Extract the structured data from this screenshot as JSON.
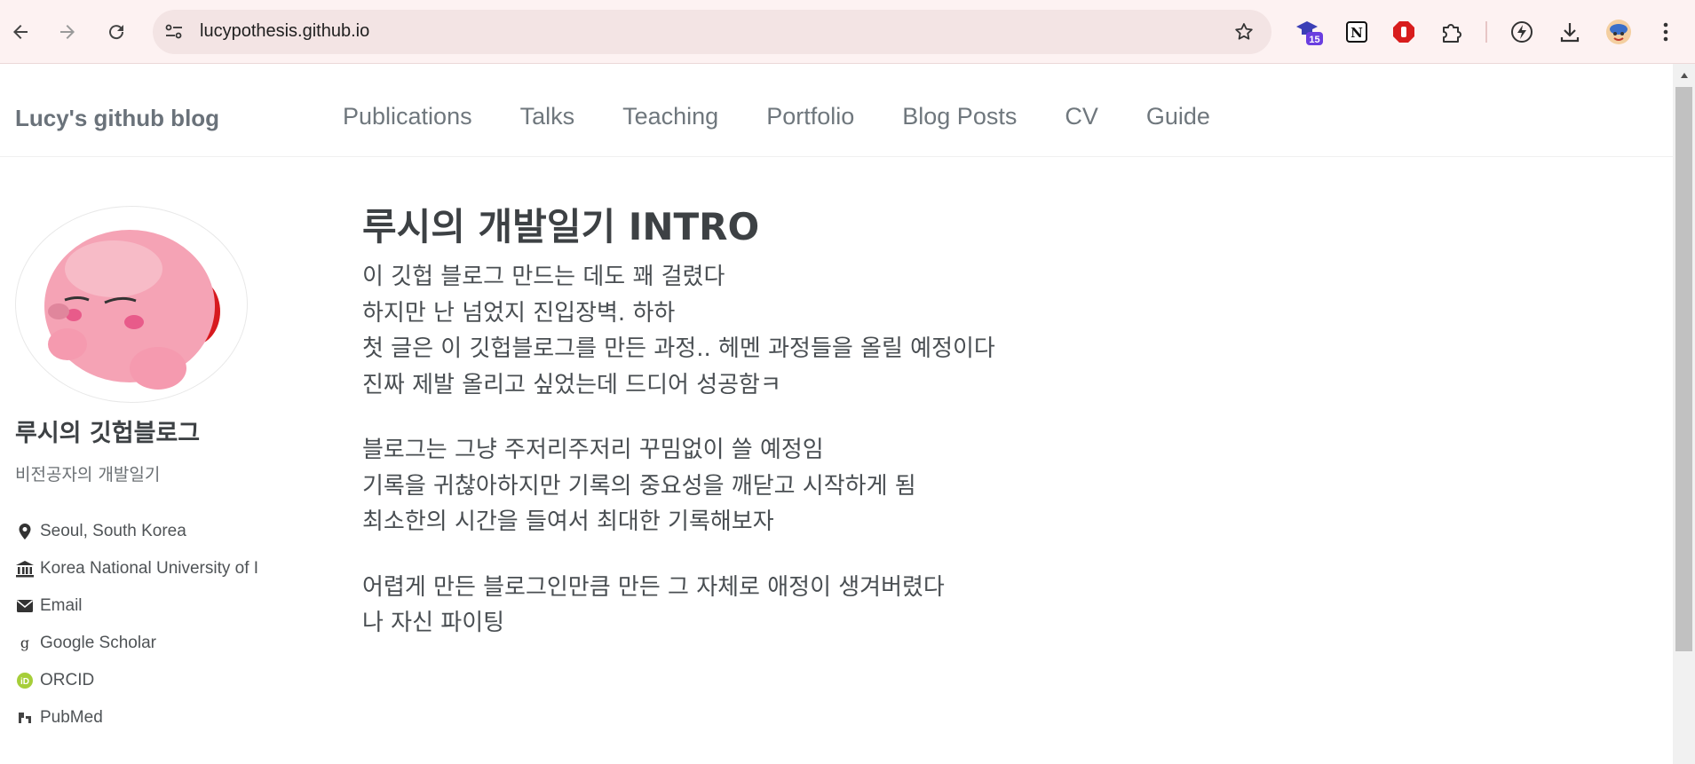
{
  "browser": {
    "url": "lucypothesis.github.io",
    "extensions": [
      {
        "name": "hat-extension-icon",
        "badge": "15"
      },
      {
        "name": "notion-icon"
      },
      {
        "name": "stop-hand-icon"
      },
      {
        "name": "puzzle-extensions-icon"
      },
      {
        "name": "bolt-circle-icon"
      },
      {
        "name": "download-icon"
      },
      {
        "name": "profile-avatar-icon"
      },
      {
        "name": "more-menu-icon"
      }
    ]
  },
  "site": {
    "brand": "Lucy's github blog",
    "nav": [
      "Publications",
      "Talks",
      "Teaching",
      "Portfolio",
      "Blog Posts",
      "CV",
      "Guide"
    ]
  },
  "author": {
    "name": "루시의 깃헙블로그",
    "bio": "비전공자의 개발일기",
    "links": [
      {
        "icon": "map-marker-icon",
        "label": "Seoul, South Korea"
      },
      {
        "icon": "university-icon",
        "label": "Korea National University of I"
      },
      {
        "icon": "envelope-icon",
        "label": "Email"
      },
      {
        "icon": "google-scholar-icon",
        "label": "Google Scholar"
      },
      {
        "icon": "orcid-icon",
        "label": "ORCID"
      },
      {
        "icon": "pubmed-icon",
        "label": "PubMed"
      }
    ]
  },
  "post": {
    "title": "루시의 개발일기 INTRO",
    "paragraphs": [
      [
        "이 깃헙 블로그 만드는 데도 꽤 걸렸다",
        "하지만 난 넘었지 진입장벽. 하하",
        "첫 글은 이 깃헙블로그를 만든 과정.. 헤멘 과정들을 올릴 예정이다",
        "진짜 제발 올리고 싶었는데 드디어 성공함ㅋ"
      ],
      [
        "블로그는 그냥 주저리주저리 꾸밈없이 쓸 예정임",
        "기록을 귀찮아하지만 기록의 중요성을 깨닫고 시작하게 됨",
        "최소한의 시간을 들여서 최대한 기록해보자"
      ],
      [
        "어렵게 만든 블로그인만큼 만든 그 자체로 애정이 생겨버렸다",
        "나 자신 파이팅"
      ]
    ]
  },
  "colors": {
    "chrome_bg": "#fdf2f2",
    "omnibox_bg": "#f3e4e4",
    "nav_text": "#6f777d",
    "heading": "#3d4144",
    "body_text": "#494e52"
  }
}
